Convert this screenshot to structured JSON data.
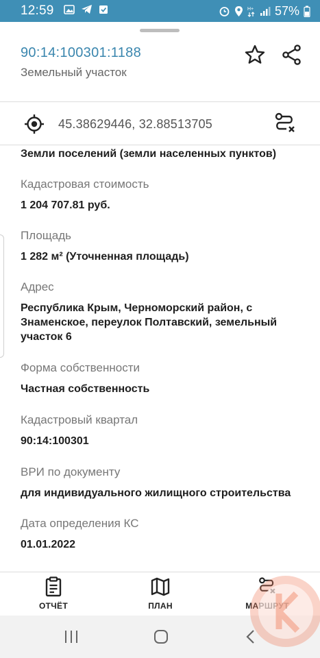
{
  "status_bar": {
    "time": "12:59",
    "battery": "57%",
    "bg_color": "#3f8fb6"
  },
  "header": {
    "cadastral_number": "90:14:100301:1188",
    "object_type": "Земельный участок",
    "accent_color": "#3a86ae",
    "actions": [
      "star-icon",
      "share-icon"
    ]
  },
  "coordinates": {
    "value": "45.38629446, 32.88513705",
    "left_icon": "locate-icon",
    "right_icon": "route-icon"
  },
  "details": {
    "category_value": "Земли поселений (земли населенных пунктов)",
    "fields": [
      {
        "label": "Кадастровая стоимость",
        "value": "1 204 707.81 руб."
      },
      {
        "label": "Площадь",
        "value": "1 282 м² (Уточненная площадь)"
      },
      {
        "label": "Адрес",
        "value": "Республика Крым, Черноморский район, с Знаменское, переулок Полтавский, земельный участок 6"
      },
      {
        "label": "Форма собственности",
        "value": "Частная собственность"
      },
      {
        "label": "Кадастровый квартал",
        "value": "90:14:100301"
      },
      {
        "label": "ВРИ по документу",
        "value": "для индивидуального жилищного строительства"
      },
      {
        "label": "Дата определения КС",
        "value": "01.01.2022"
      }
    ]
  },
  "bottom_nav": {
    "items": [
      {
        "label": "ОТЧЁТ",
        "icon": "report-icon"
      },
      {
        "label": "ПЛАН",
        "icon": "map-icon"
      },
      {
        "label": "МАРШРУТ",
        "icon": "route-icon"
      }
    ]
  },
  "system_nav": [
    "recent-apps-icon",
    "home-icon",
    "back-icon"
  ]
}
